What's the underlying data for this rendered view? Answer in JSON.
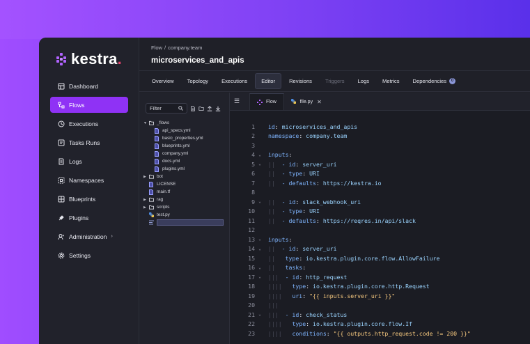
{
  "brand": {
    "name": "kestra",
    "dot": "."
  },
  "sidebar": {
    "items": [
      {
        "label": "Dashboard",
        "icon": "dashboard-icon",
        "active": false
      },
      {
        "label": "Flows",
        "icon": "flows-icon",
        "active": true
      },
      {
        "label": "Executions",
        "icon": "executions-icon",
        "active": false
      },
      {
        "label": "Tasks Runs",
        "icon": "tasks-runs-icon",
        "active": false
      },
      {
        "label": "Logs",
        "icon": "logs-icon",
        "active": false
      },
      {
        "label": "Namespaces",
        "icon": "namespaces-icon",
        "active": false
      },
      {
        "label": "Blueprints",
        "icon": "blueprints-icon",
        "active": false
      },
      {
        "label": "Plugins",
        "icon": "plugins-icon",
        "active": false
      },
      {
        "label": "Administration",
        "icon": "administration-icon",
        "active": false,
        "chevron": "›"
      },
      {
        "label": "Settings",
        "icon": "gear-icon",
        "active": false
      }
    ]
  },
  "header": {
    "breadcrumb": {
      "root": "Flow",
      "separator": "/",
      "namespace": "company.team"
    },
    "title": "microservices_and_apis"
  },
  "tabs": [
    {
      "label": "Overview",
      "state": "normal"
    },
    {
      "label": "Topology",
      "state": "normal"
    },
    {
      "label": "Executions",
      "state": "normal"
    },
    {
      "label": "Editor",
      "state": "active"
    },
    {
      "label": "Revisions",
      "state": "normal"
    },
    {
      "label": "Triggers",
      "state": "disabled"
    },
    {
      "label": "Logs",
      "state": "normal"
    },
    {
      "label": "Metrics",
      "state": "normal"
    },
    {
      "label": "Dependencies",
      "state": "normal",
      "badge": "0"
    }
  ],
  "explorer": {
    "filter_placeholder": "Filter",
    "tree": [
      {
        "label": "_flows",
        "type": "folder",
        "open": true,
        "depth": 0
      },
      {
        "label": "api_specs.yml",
        "type": "file",
        "depth": 1
      },
      {
        "label": "basic_properties.yml",
        "type": "file",
        "depth": 1
      },
      {
        "label": "blueprints.yml",
        "type": "file",
        "depth": 1
      },
      {
        "label": "company.yml",
        "type": "file",
        "depth": 1
      },
      {
        "label": "docs.yml",
        "type": "file",
        "depth": 1
      },
      {
        "label": "plugins.yml",
        "type": "file",
        "depth": 1
      },
      {
        "label": "bot",
        "type": "folder",
        "open": false,
        "depth": 0
      },
      {
        "label": "LICENSE",
        "type": "file",
        "depth": 0
      },
      {
        "label": "main.tf",
        "type": "file",
        "depth": 0
      },
      {
        "label": "rag",
        "type": "folder",
        "open": false,
        "depth": 0
      },
      {
        "label": "scripts",
        "type": "folder",
        "open": false,
        "depth": 0
      },
      {
        "label": "test.py",
        "type": "python",
        "depth": 0
      },
      {
        "label": "",
        "type": "new",
        "depth": 0
      }
    ]
  },
  "editor": {
    "tabs": [
      {
        "label": "Flow",
        "icon": "kestra-icon",
        "active": true,
        "closable": false
      },
      {
        "label": "file.py",
        "icon": "python-icon",
        "active": false,
        "closable": true
      }
    ],
    "lines": [
      {
        "n": "1",
        "fold": "",
        "guides": "",
        "key": "id",
        "val": "microservices_and_apis",
        "kind": "v"
      },
      {
        "n": "2",
        "fold": "",
        "guides": "",
        "key": "namespace",
        "val": "company.team",
        "kind": "v"
      },
      {
        "n": "3",
        "fold": "",
        "guides": "",
        "key": "",
        "val": "",
        "kind": ""
      },
      {
        "n": "4",
        "fold": "v",
        "guides": "",
        "key": "inputs",
        "val": "",
        "kind": ""
      },
      {
        "n": "5",
        "fold": "v",
        "guides": "||  ",
        "key": "- id",
        "val": "server_uri",
        "kind": "v"
      },
      {
        "n": "6",
        "fold": "",
        "guides": "||  ",
        "key": "- type",
        "val": "URI",
        "kind": "v"
      },
      {
        "n": "7",
        "fold": "",
        "guides": "||  ",
        "key": "- defaults",
        "val": "https://kestra.io",
        "kind": "v"
      },
      {
        "n": "8",
        "fold": "",
        "guides": "",
        "key": "",
        "val": "",
        "kind": ""
      },
      {
        "n": "9",
        "fold": "v",
        "guides": "||  ",
        "key": "- id",
        "val": "slack_webhook_uri",
        "kind": "v"
      },
      {
        "n": "10",
        "fold": "",
        "guides": "||  ",
        "key": "- type",
        "val": "URI",
        "kind": "v"
      },
      {
        "n": "11",
        "fold": "",
        "guides": "||  ",
        "key": "- defaults",
        "val": "https://reqres.in/api/slack",
        "kind": "v"
      },
      {
        "n": "12",
        "fold": "",
        "guides": "",
        "key": "",
        "val": "",
        "kind": ""
      },
      {
        "n": "13",
        "fold": "v",
        "guides": "",
        "key": "inputs",
        "val": "",
        "kind": ""
      },
      {
        "n": "14",
        "fold": "v",
        "guides": "||  ",
        "key": "- id",
        "val": "server_uri",
        "kind": "v"
      },
      {
        "n": "15",
        "fold": "",
        "guides": "||   ",
        "key": "type",
        "val": "io.kestra.plugin.core.flow.AllowFailure",
        "kind": "v"
      },
      {
        "n": "16",
        "fold": "v",
        "guides": "||   ",
        "key": "tasks",
        "val": "",
        "kind": ""
      },
      {
        "n": "17",
        "fold": "v",
        "guides": "|||  ",
        "key": "- id",
        "val": "http_request",
        "kind": "v"
      },
      {
        "n": "18",
        "fold": "",
        "guides": "||||   ",
        "key": "type",
        "val": "io.kestra.plugin.core.http.Request",
        "kind": "v"
      },
      {
        "n": "19",
        "fold": "",
        "guides": "||||   ",
        "key": "uri",
        "val": "\"{{ inputs.server_uri }}\"",
        "kind": "s"
      },
      {
        "n": "20",
        "fold": "",
        "guides": "|||",
        "key": "",
        "val": "",
        "kind": ""
      },
      {
        "n": "21",
        "fold": "v",
        "guides": "|||  ",
        "key": "- id",
        "val": "check_status",
        "kind": "v"
      },
      {
        "n": "22",
        "fold": "",
        "guides": "||||   ",
        "key": "type",
        "val": "io.kestra.plugin.core.flow.If",
        "kind": "v"
      },
      {
        "n": "23",
        "fold": "",
        "guides": "||||   ",
        "key": "conditions",
        "val": "\"{{ outputs.http_request.code != 200 }}\"",
        "kind": "s"
      }
    ]
  },
  "colors": {
    "accent": "#8f32f5",
    "background_gradient_start": "#a04dff",
    "background_gradient_end": "#4f2ce6"
  }
}
